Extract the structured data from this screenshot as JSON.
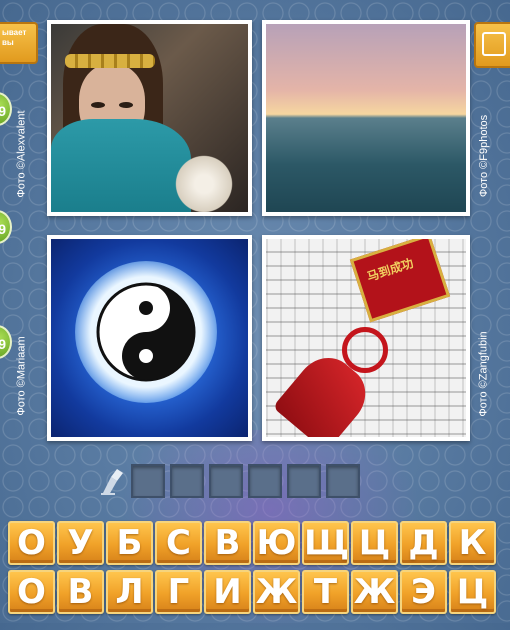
{
  "hint_left_label": "ывает\nвы",
  "coins": [
    "9",
    "9",
    "9"
  ],
  "credits": {
    "top_left": "Фото ©Alexvalent",
    "top_right": "Фото ©F9photos",
    "bottom_left": "Фото ©Mariaam",
    "bottom_right": "Фото ©Zangfubin"
  },
  "answer_slots": 6,
  "keyboard": {
    "row1": [
      "О",
      "У",
      "Б",
      "С",
      "В",
      "Ю",
      "Щ",
      "Ц",
      "Д",
      "К"
    ],
    "row2": [
      "О",
      "В",
      "Л",
      "Г",
      "И",
      "Ж",
      "Т",
      "Ж",
      "Э",
      "Ц"
    ]
  },
  "tag_text": "马到成功",
  "colors": {
    "key_orange": "#f0a128",
    "coin_green": "#7bbf2a",
    "slot_blue": "#5a6f8a"
  }
}
